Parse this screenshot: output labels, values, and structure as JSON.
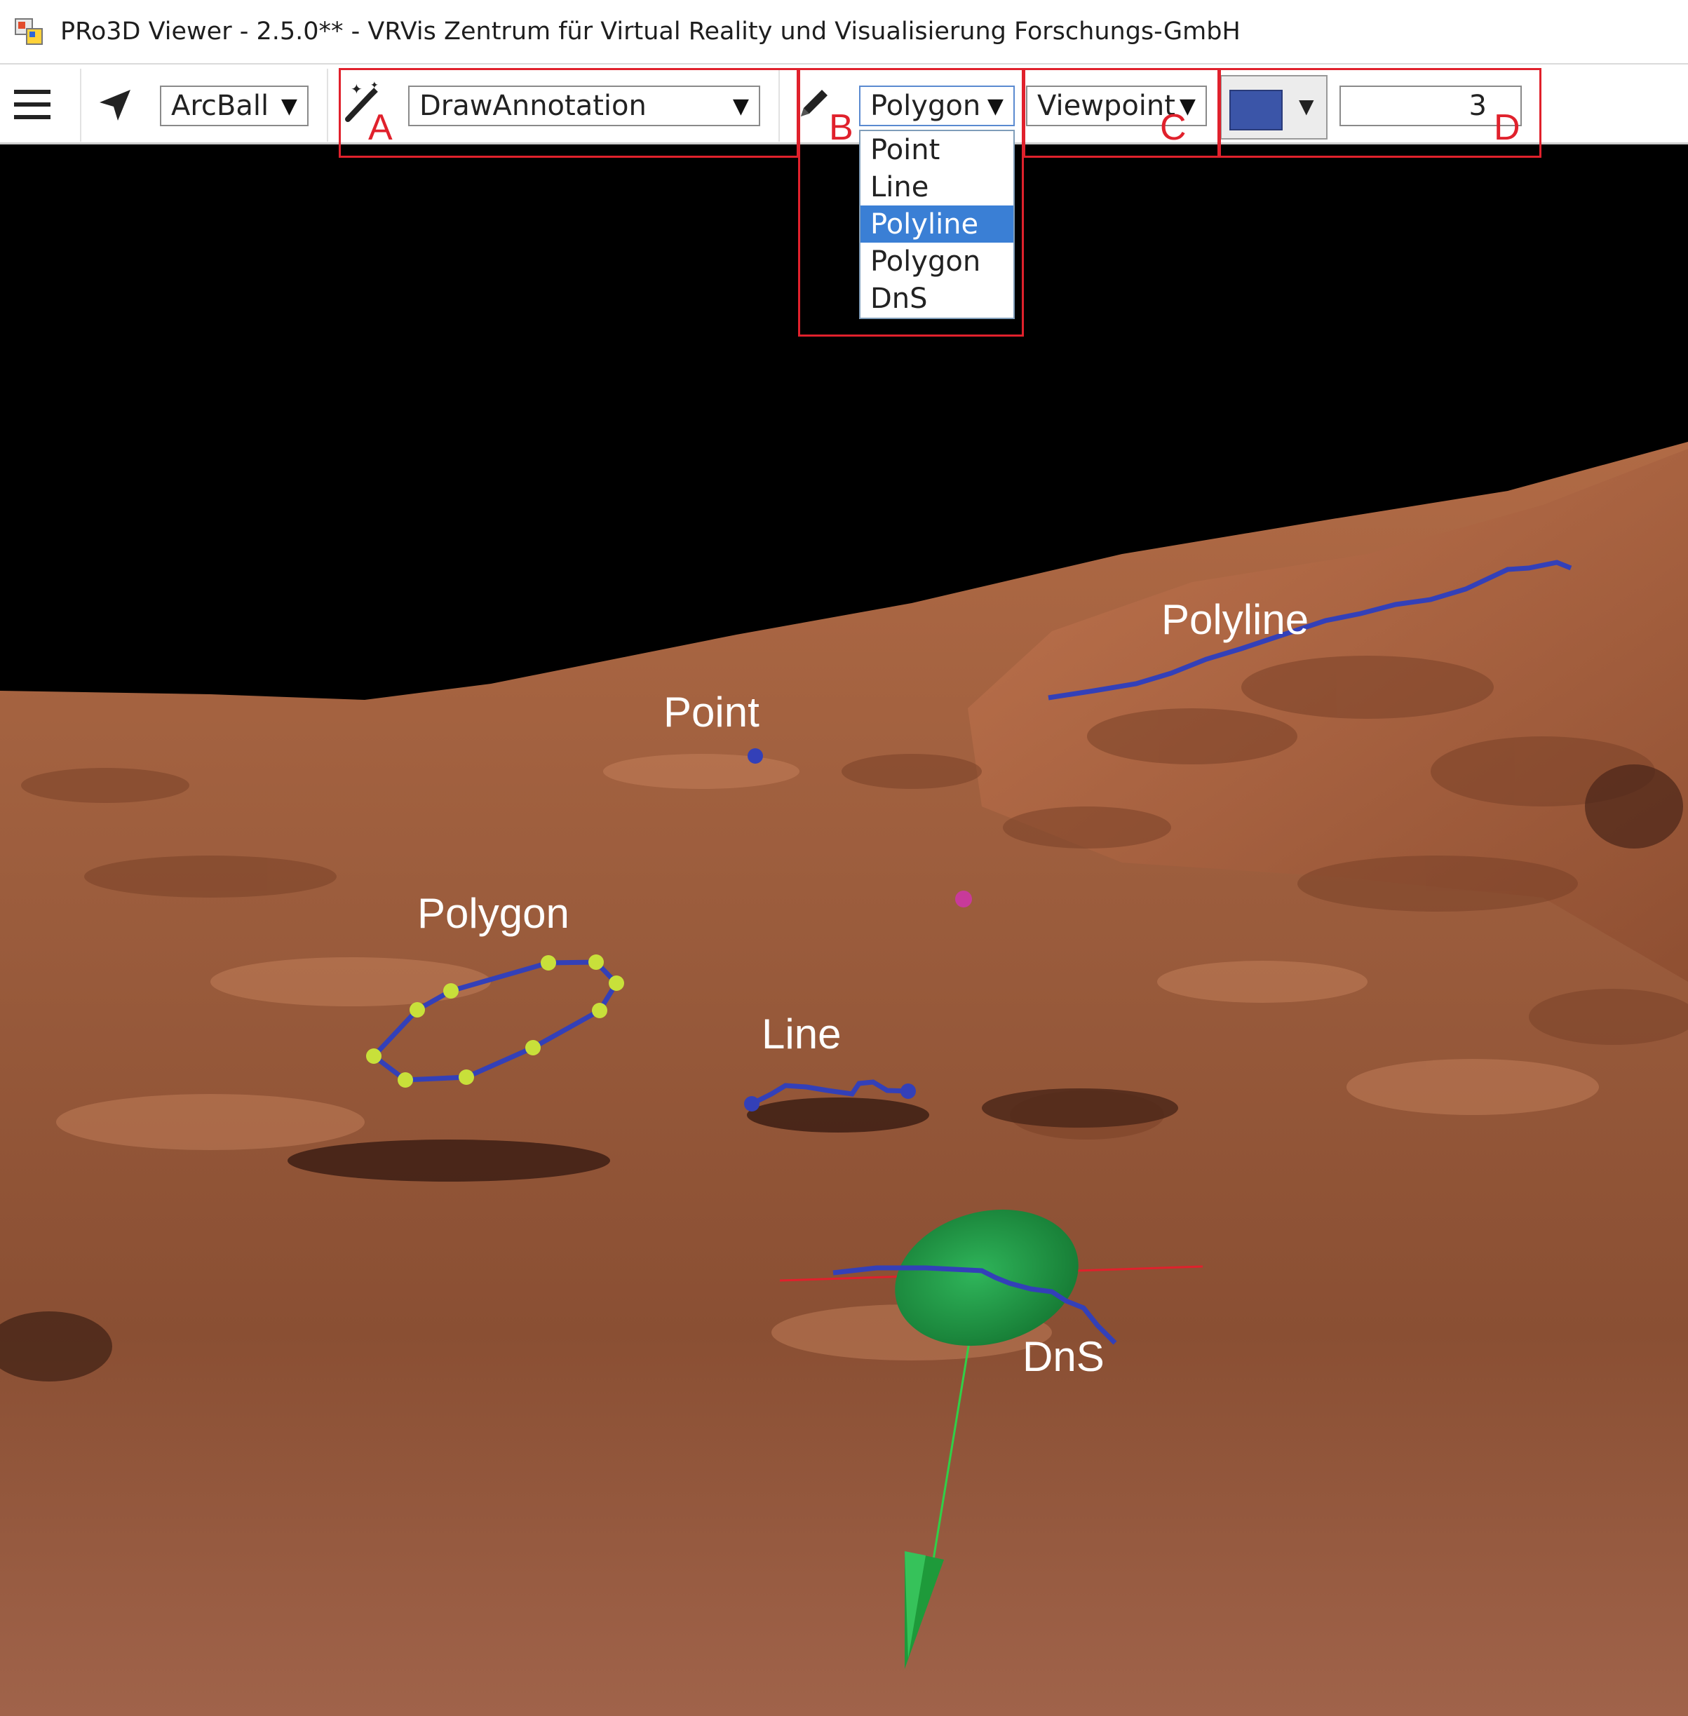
{
  "window": {
    "title": "PRo3D Viewer - 2.5.0** - VRVis Zentrum für Virtual Reality und Visualisierung Forschungs-GmbH"
  },
  "toolbar": {
    "navigation_mode": "ArcBall",
    "interaction_mode": "DrawAnnotation",
    "geometry_type": "Polygon",
    "projection": "Viewpoint",
    "thickness": "3",
    "annotation_color": "#3b55a8"
  },
  "geometry_dropdown": {
    "options": [
      "Point",
      "Line",
      "Polyline",
      "Polygon",
      "DnS"
    ],
    "highlighted": "Polyline"
  },
  "callouts": {
    "a": "A",
    "b": "B",
    "c": "C",
    "d": "D"
  },
  "annotations": {
    "point": "Point",
    "polyline": "Polyline",
    "polygon": "Polygon",
    "line": "Line",
    "dns": "DnS"
  },
  "colors": {
    "highlight": "#e0212c",
    "annotation_line": "#3340b8",
    "vertex": "#c8e03a",
    "dns_plane": "#1e9a3a",
    "sky": "#000000"
  }
}
